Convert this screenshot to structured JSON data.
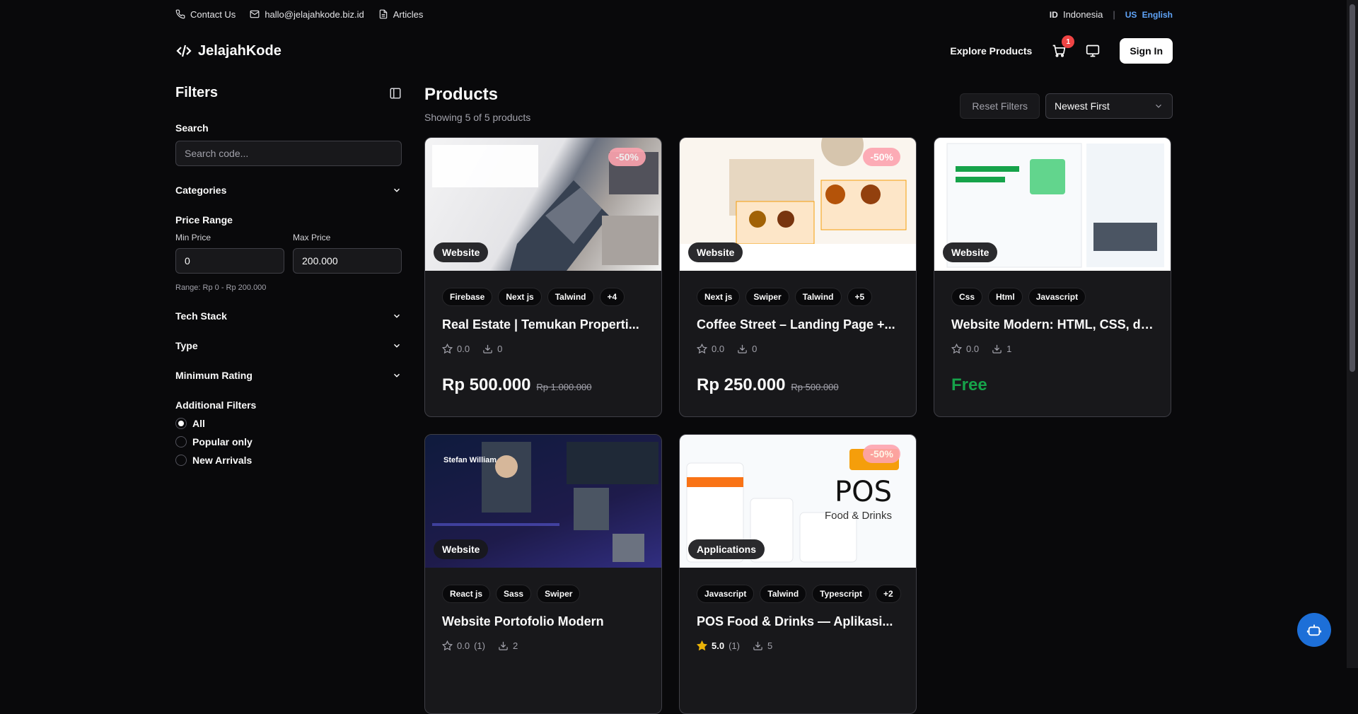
{
  "topbar": {
    "contact": "Contact Us",
    "email": "hallo@jelajahkode.biz.id",
    "articles": "Articles",
    "lang_id_code": "ID",
    "lang_id_label": "Indonesia",
    "lang_sep": "|",
    "lang_us_code": "US",
    "lang_us_label": "English"
  },
  "header": {
    "brand": "JelajahKode",
    "explore": "Explore Products",
    "cart_count": "1",
    "signin": "Sign In"
  },
  "sidebar": {
    "title": "Filters",
    "search_label": "Search",
    "search_placeholder": "Search code...",
    "categories": "Categories",
    "price_range": "Price Range",
    "min_label": "Min Price",
    "max_label": "Max Price",
    "min_value": "0",
    "max_value": "200.000",
    "range_text": "Range: Rp 0 - Rp 200.000",
    "tech_stack": "Tech Stack",
    "type": "Type",
    "minimum_rating": "Minimum Rating",
    "additional": "Additional Filters",
    "radios": [
      "All",
      "Popular only",
      "New Arrivals"
    ]
  },
  "main": {
    "title": "Products",
    "count": "Showing 5 of 5 products",
    "reset": "Reset Filters",
    "sort": "Newest First"
  },
  "products": [
    {
      "type": "Website",
      "sale": "-50%",
      "tags": [
        "Firebase",
        "Next js",
        "Talwind",
        "+4"
      ],
      "title": "Real Estate | Temukan Properti...",
      "rating": "0.0",
      "reviews": "",
      "downloads": "0",
      "price": "Rp 500.000",
      "old_price": "Rp 1.000.000"
    },
    {
      "type": "Website",
      "sale": "-50%",
      "tags": [
        "Next js",
        "Swiper",
        "Talwind",
        "+5"
      ],
      "title": "Coffee Street – Landing Page +...",
      "rating": "0.0",
      "reviews": "",
      "downloads": "0",
      "price": "Rp 250.000",
      "old_price": "Rp 500.000"
    },
    {
      "type": "Website",
      "sale": "",
      "tags": [
        "Css",
        "Html",
        "Javascript"
      ],
      "title": "Website Modern: HTML, CSS, da...",
      "rating": "0.0",
      "reviews": "",
      "downloads": "1",
      "price": "Free",
      "old_price": ""
    },
    {
      "type": "Website",
      "sale": "",
      "tags": [
        "React js",
        "Sass",
        "Swiper"
      ],
      "title": "Website Portofolio Modern",
      "rating": "0.0",
      "reviews": "(1)",
      "downloads": "2",
      "price": "",
      "old_price": ""
    },
    {
      "type": "Applications",
      "sale": "-50%",
      "tags": [
        "Javascript",
        "Talwind",
        "Typescript",
        "+2"
      ],
      "title": "POS Food & Drinks — Aplikasi...",
      "rating": "5.0",
      "reviews": "(1)",
      "downloads": "5",
      "price": "",
      "old_price": ""
    }
  ],
  "thumb_texts": {
    "pos_title": "POS",
    "pos_sub": "Food & Drinks",
    "portfolio_name": "Stefan William"
  },
  "colors": {
    "accent": "#60a5fa",
    "free": "#16a34a",
    "badge": "#ef4444",
    "bot": "#1d6fd8"
  }
}
